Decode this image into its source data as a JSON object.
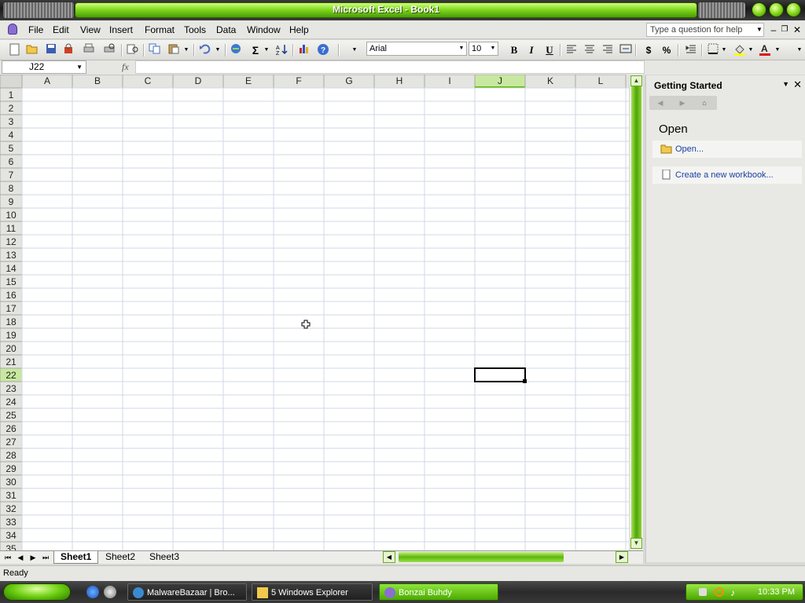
{
  "window": {
    "title": "Microsoft Excel - Book1"
  },
  "menu": {
    "items": [
      {
        "label": "File",
        "name": "menu-file"
      },
      {
        "label": "Edit",
        "name": "menu-edit"
      },
      {
        "label": "View",
        "name": "menu-view"
      },
      {
        "label": "Insert",
        "name": "menu-insert"
      },
      {
        "label": "Format",
        "name": "menu-format"
      },
      {
        "label": "Tools",
        "name": "menu-tools"
      },
      {
        "label": "Data",
        "name": "menu-data"
      },
      {
        "label": "Window",
        "name": "menu-window"
      },
      {
        "label": "Help",
        "name": "menu-help"
      }
    ],
    "help_placeholder": "Type a question for help"
  },
  "toolbar": {
    "font_name": "Arial",
    "font_size": "10",
    "bold": "B",
    "italic": "I",
    "underline": "U",
    "currency": "$",
    "percent": "%",
    "sum": "Σ"
  },
  "formula": {
    "name_box": "J22",
    "fx": "fx",
    "value": ""
  },
  "grid": {
    "columns": [
      "A",
      "B",
      "C",
      "D",
      "E",
      "F",
      "G",
      "H",
      "I",
      "J",
      "K",
      "L"
    ],
    "row_count": 35,
    "active_cell": "J22",
    "active_column": "J",
    "active_row": 22
  },
  "sheets": {
    "tabs": [
      "Sheet1",
      "Sheet2",
      "Sheet3"
    ],
    "active": "Sheet1"
  },
  "taskpane": {
    "title": "Getting Started",
    "section": "Open",
    "links": [
      "Open...",
      "Create a new workbook..."
    ]
  },
  "status": {
    "text": "Ready"
  },
  "taskbar": {
    "items": [
      "MalwareBazaar | Bro...",
      "5 Windows Explorer",
      "Bonzai Buhdy"
    ],
    "clock": "10:33 PM"
  },
  "colors": {
    "accent": "#5cb808",
    "gridline": "#d0d7e5",
    "header_bg": "#e4e4e0"
  }
}
